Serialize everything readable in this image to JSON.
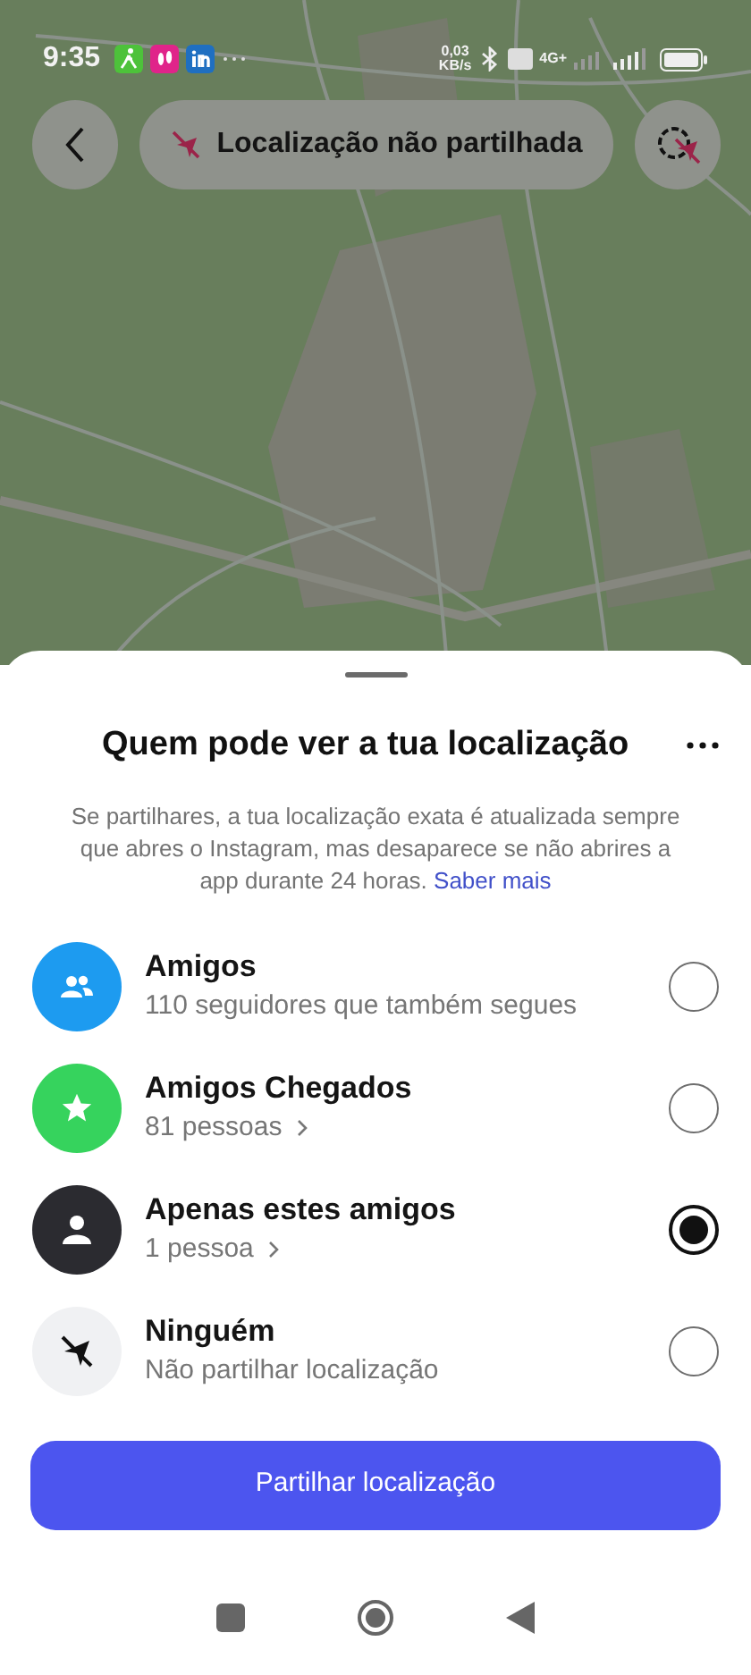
{
  "status_bar": {
    "time": "9:35",
    "net_speed": "0,03",
    "net_unit": "KB/s",
    "network": "4G+"
  },
  "top_bar": {
    "location_status": "Localização não partilhada"
  },
  "sheet": {
    "title": "Quem pode ver a tua localização",
    "description": "Se partilhares, a tua localização exata é atualizada sempre que abres o Instagram, mas desaparece se não abrires a app durante 24 horas.",
    "learn_more": "Saber mais",
    "options": [
      {
        "kind": "friends",
        "title": "Amigos",
        "subtitle": "110 seguidores que também segues",
        "color": "#1d9bf0",
        "expandable": false,
        "selected": false
      },
      {
        "kind": "close_friends",
        "title": "Amigos Chegados",
        "subtitle": "81 pessoas",
        "color": "#36d35d",
        "expandable": true,
        "selected": false
      },
      {
        "kind": "specific",
        "title": "Apenas estes amigos",
        "subtitle": "1 pessoa",
        "color": "#2b2b30",
        "expandable": true,
        "selected": true
      },
      {
        "kind": "none",
        "title": "Ninguém",
        "subtitle": "Não partilhar localização",
        "color": "#f0f1f3",
        "expandable": false,
        "selected": false
      }
    ],
    "button": "Partilhar localização"
  }
}
